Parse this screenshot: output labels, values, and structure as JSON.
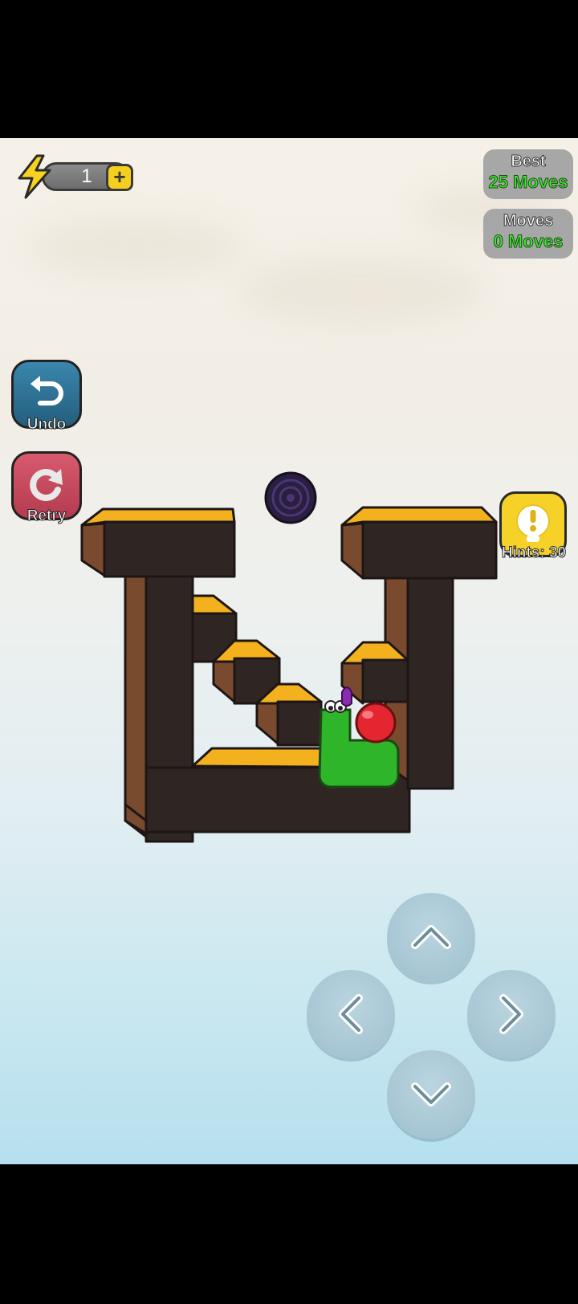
{
  "energy": {
    "count": "1",
    "plus_label": "+"
  },
  "stats": {
    "best": {
      "label": "Best",
      "value": "25 Moves"
    },
    "moves": {
      "label": "Moves",
      "value": "0 Moves"
    }
  },
  "buttons": {
    "undo_label": "Undo",
    "retry_label": "Retry",
    "hints_label": "Hints: 30"
  },
  "icons": {
    "energy": "lightning-bolt-icon",
    "undo": "undo-arrow-icon",
    "retry": "retry-arrow-icon",
    "hint": "exclamation-bulb-icon",
    "up": "chevron-up-icon",
    "left": "chevron-left-icon",
    "right": "chevron-right-icon",
    "down": "chevron-down-icon"
  },
  "colors": {
    "best_value": "#3dea30",
    "undo_button": "#2d6f93",
    "retry_button": "#c94a5e",
    "hint_button": "#f6d128",
    "block_top": "#f3b11e",
    "block_dark": "#2f2624",
    "worm_body": "#2fb52a",
    "apple": "#e3262f",
    "portal": "#3b2a5a"
  }
}
